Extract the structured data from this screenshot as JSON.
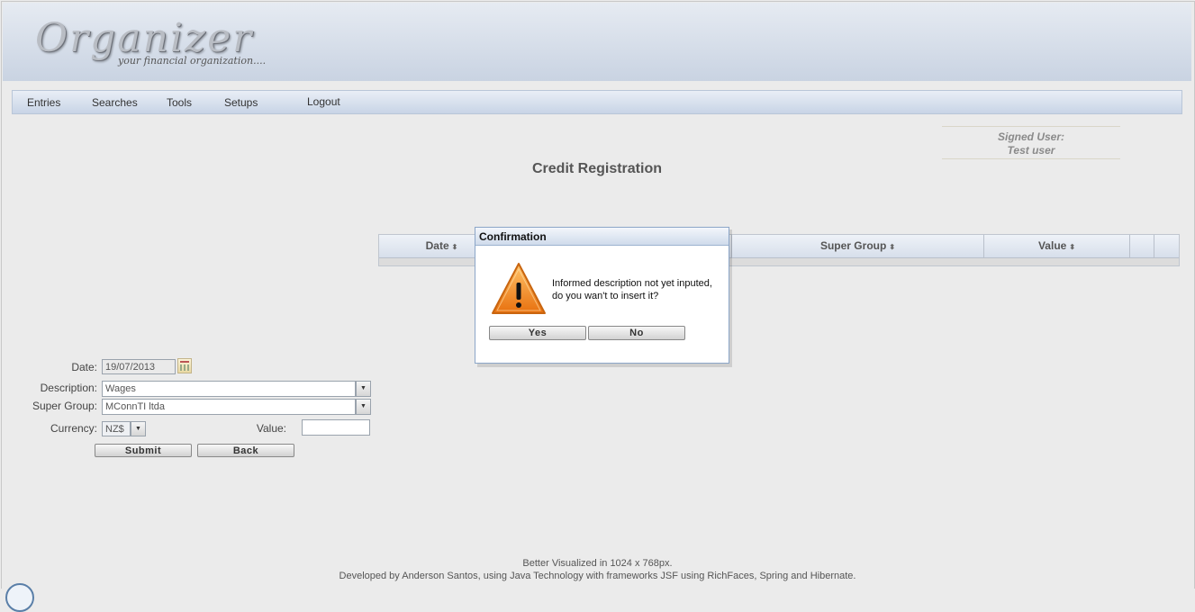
{
  "app": {
    "logo_title": "Organizer",
    "logo_subtitle": "your financial organization...."
  },
  "menu": {
    "items": [
      "Entries",
      "Searches",
      "Tools",
      "Setups",
      "Logout"
    ]
  },
  "user": {
    "label": "Signed User:",
    "name": "Test user"
  },
  "page": {
    "title": "Credit Registration"
  },
  "table": {
    "columns": [
      "Date",
      "Super Group",
      "Value"
    ],
    "sort_indicator": "⬍"
  },
  "form": {
    "date_label": "Date:",
    "date_value": "19/07/2013",
    "description_label": "Description:",
    "description_value": "Wages",
    "super_group_label": "Super Group:",
    "super_group_value": "MConnTI ltda",
    "currency_label": "Currency:",
    "currency_value": "NZ$",
    "value_label": "Value:",
    "value_value": "",
    "submit_label": "Submit",
    "back_label": "Back"
  },
  "dialog": {
    "title": "Confirmation",
    "message_line1": "Informed description not yet inputed,",
    "message_line2": "do you wan't to insert it?",
    "yes_label": "Yes",
    "no_label": "No"
  },
  "footer": {
    "line1": "Better Visualized in 1024 x 768px.",
    "line2": "Developed by Anderson Santos, using Java Technology with frameworks JSF using RichFaces, Spring and Hibernate."
  },
  "colors": {
    "header_bg": "#c9d3e2",
    "page_bg": "#ebebeb",
    "warning_orange": "#f08a1c"
  }
}
